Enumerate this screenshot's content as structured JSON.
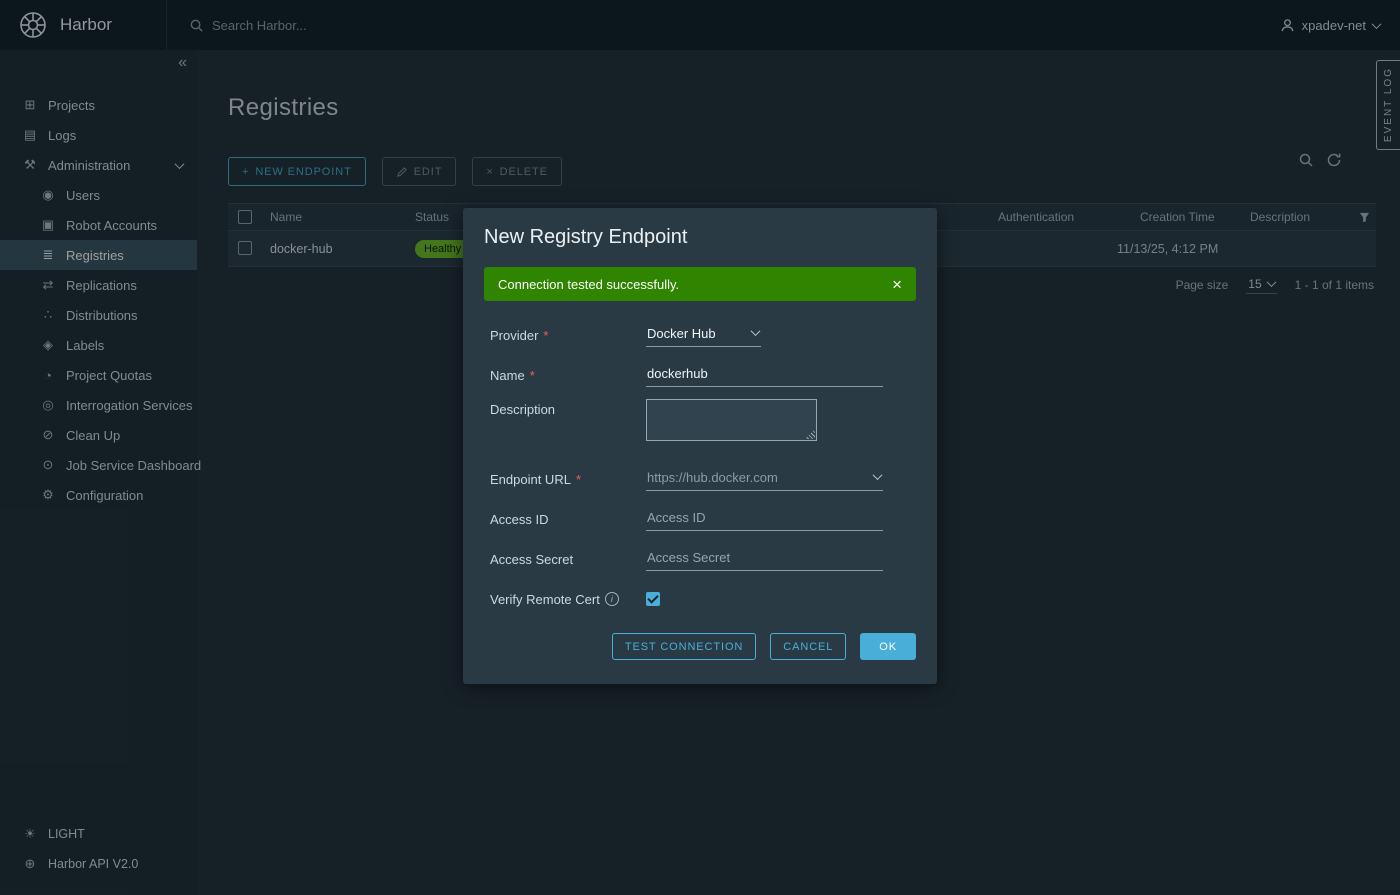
{
  "icons": {
    "plus": "+",
    "close": "×",
    "collapse": "«"
  },
  "topbar": {
    "brand": "Harbor",
    "search_placeholder": "Search Harbor...",
    "user": "xpadev-net"
  },
  "sidebar": {
    "items": [
      {
        "icon": "⊞",
        "label": "Projects"
      },
      {
        "icon": "▤",
        "label": "Logs"
      },
      {
        "icon": "⚒",
        "label": "Administration"
      }
    ],
    "admin_items": [
      {
        "icon": "◉",
        "label": "Users"
      },
      {
        "icon": "▣",
        "label": "Robot Accounts"
      },
      {
        "icon": "≣",
        "label": "Registries"
      },
      {
        "icon": "⇄",
        "label": "Replications"
      },
      {
        "icon": "∴",
        "label": "Distributions"
      },
      {
        "icon": "◈",
        "label": "Labels"
      },
      {
        "icon": "◔",
        "label": "Project Quotas"
      },
      {
        "icon": "◎",
        "label": "Interrogation Services"
      },
      {
        "icon": "⊘",
        "label": "Clean Up"
      },
      {
        "icon": "⊙",
        "label": "Job Service Dashboard"
      },
      {
        "icon": "⚙",
        "label": "Configuration"
      }
    ],
    "footer": [
      {
        "icon": "☀",
        "label": "LIGHT"
      },
      {
        "icon": "⊕",
        "label": "Harbor API V2.0"
      }
    ]
  },
  "page": {
    "title": "Registries",
    "event_log": "EVENT LOG",
    "toolbar": {
      "new_endpoint": "NEW ENDPOINT",
      "edit": "EDIT",
      "delete": "DELETE"
    }
  },
  "table": {
    "columns": [
      {
        "label": "Name"
      },
      {
        "label": "Status"
      },
      {
        "label": "Authentication"
      },
      {
        "label": "Creation Time"
      },
      {
        "label": "Description"
      }
    ],
    "row": {
      "name": "docker-hub",
      "status": "Healthy",
      "creation_time": "11/13/25, 4:12 PM"
    },
    "footer": {
      "page_size_label": "Page size",
      "page_size": "15",
      "range": "1 - 1 of 1 items"
    }
  },
  "modal": {
    "title": "New Registry Endpoint",
    "required_mark": "*",
    "alert": {
      "message": "Connection tested successfully."
    },
    "fields": {
      "provider": {
        "label": "Provider",
        "value": "Docker Hub"
      },
      "name": {
        "label": "Name",
        "value": "dockerhub"
      },
      "description": {
        "label": "Description",
        "value": ""
      },
      "endpoint": {
        "label": "Endpoint URL",
        "value": "https://hub.docker.com"
      },
      "access_id": {
        "label": "Access ID",
        "placeholder": "Access ID"
      },
      "access_secret": {
        "label": "Access Secret",
        "placeholder": "Access Secret"
      },
      "verify_cert": {
        "label": "Verify Remote Cert",
        "checked": true
      }
    },
    "buttons": {
      "test": "TEST CONNECTION",
      "cancel": "CANCEL",
      "ok": "OK"
    }
  }
}
